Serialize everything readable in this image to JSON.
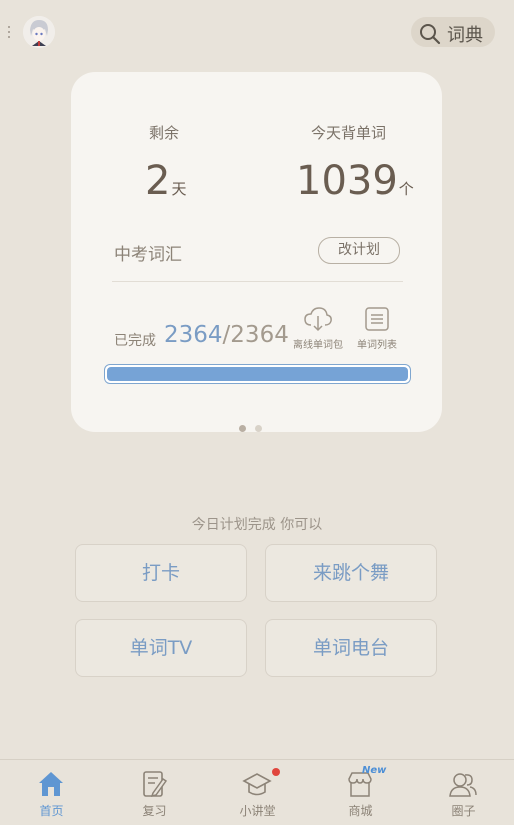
{
  "header": {
    "search_label": "词典"
  },
  "card": {
    "remaining_label": "剩余",
    "remaining_value": "2",
    "remaining_unit": "天",
    "today_label": "今天背单词",
    "today_value": "1039",
    "today_unit": "个",
    "plan_name": "中考词汇",
    "change_plan_label": "改计划",
    "completed_label": "已完成",
    "completed_value": "2364",
    "completed_separator": "/",
    "total_value": "2364",
    "progress_fraction": 1.0,
    "offline_pack_label": "离线单词包",
    "word_list_label": "单词列表"
  },
  "today": {
    "message": "今日计划完成 你可以",
    "actions": [
      "打卡",
      "来跳个舞",
      "单词TV",
      "单词电台"
    ]
  },
  "nav": {
    "items": [
      {
        "label": "首页",
        "icon": "home-icon"
      },
      {
        "label": "复习",
        "icon": "review-icon"
      },
      {
        "label": "小讲堂",
        "icon": "graduation-cap-icon"
      },
      {
        "label": "商城",
        "icon": "store-icon"
      },
      {
        "label": "圈子",
        "icon": "people-icon"
      }
    ],
    "new_badge": "New"
  },
  "colors": {
    "accent": "#76a3d6",
    "background": "#e8e3da",
    "card": "#f7f5f1",
    "badge_red": "#e0463d"
  }
}
